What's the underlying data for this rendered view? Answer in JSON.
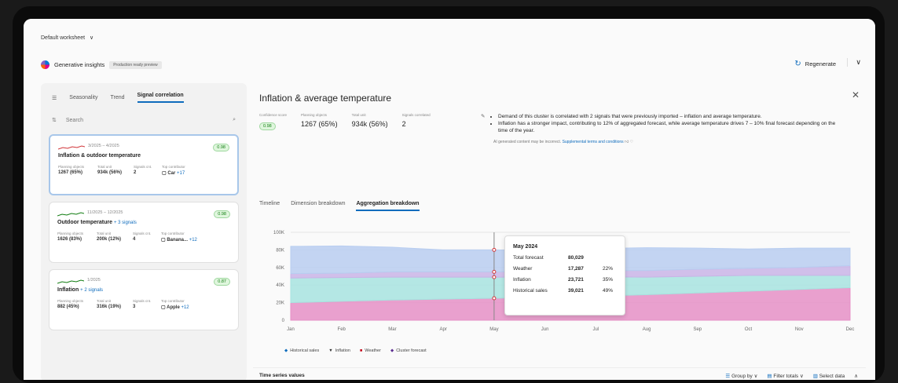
{
  "worksheet": {
    "label": "Default worksheet",
    "chevron": "∨"
  },
  "header": {
    "title": "Generative insights",
    "badge": "Production ready preview",
    "regenerate": "Regenerate",
    "regen_icon": "↻",
    "collapse": "∨"
  },
  "left": {
    "tabs": [
      {
        "label": "Seasonality"
      },
      {
        "label": "Trend"
      },
      {
        "label": "Signal correlation"
      }
    ],
    "search_placeholder": "Search",
    "cards": [
      {
        "date": "3/2025 – 4/2025",
        "title": "Inflation & outdoor temperature",
        "link": "",
        "score": "0.98",
        "h1": "Planning objects",
        "h2": "Total unit",
        "h3": "Signals cnt.",
        "h4": "Top contributor",
        "v1": "1267 (65%)",
        "v2": "934k (56%)",
        "v3": "2",
        "v4": "Car",
        "plus": "+17"
      },
      {
        "date": "11/2025 – 12/2025",
        "title": "Outdoor temperature",
        "link": "+ 3 signals",
        "score": "0.98",
        "h1": "Planning objects",
        "h2": "Total unit",
        "h3": "Signals cnt.",
        "h4": "Top contributor",
        "v1": "1626 (83%)",
        "v2": "200k (12%)",
        "v3": "4",
        "v4": "Banana...",
        "plus": "+12"
      },
      {
        "date": "1/2025",
        "title": "Inflation",
        "link": "+ 2 signals",
        "score": "0.87",
        "h1": "Planning objects",
        "h2": "Total unit",
        "h3": "Signals cnt.",
        "h4": "Top contributor",
        "v1": "882 (45%)",
        "v2": "316k (19%)",
        "v3": "3",
        "v4": "Apple",
        "plus": "+12"
      }
    ]
  },
  "main": {
    "title": "Inflation & average temperature",
    "stats": [
      {
        "h": "Confidence score",
        "v": "0.98"
      },
      {
        "h": "Planning objects",
        "v": "1267 (65%)"
      },
      {
        "h": "Total unit",
        "v": "934k (56%)"
      },
      {
        "h": "Signals correlated",
        "v": "2"
      }
    ],
    "ai_1": "Demand of this cluster is correlated with 2 signals that were previously imported – inflation and average temperature.",
    "ai_2": "Inflation has a stronger impact, contributing to 12% of aggregated forecast, while average temperature drives 7 – 10% final forecast depending on the time of the year.",
    "ai_foot": "AI generated content may be incorrect.",
    "ai_link": "Supplemental terms and conditions",
    "tabs": [
      {
        "label": "Timeline"
      },
      {
        "label": "Dimension breakdown"
      },
      {
        "label": "Aggregation breakdown"
      }
    ],
    "tooltip": {
      "title": "May 2024",
      "rows": [
        {
          "k": "Total forecast",
          "v": "80,029",
          "p": ""
        },
        {
          "k": "Weather",
          "v": "17,287",
          "p": "22%"
        },
        {
          "k": "Inflation",
          "v": "23,721",
          "p": "35%"
        },
        {
          "k": "Historical sales",
          "v": "39,021",
          "p": "49%"
        }
      ]
    },
    "legend": [
      {
        "label": "Historical sales",
        "color": "#0f6cbd",
        "mark": "◆"
      },
      {
        "label": "Inflation",
        "color": "#333333",
        "mark": "▼"
      },
      {
        "label": "Weather",
        "color": "#c50f1f",
        "mark": "■"
      },
      {
        "label": "Cluster forecast",
        "color": "#5c2e91",
        "mark": "◆"
      }
    ],
    "bottom": {
      "title": "Time series values",
      "group": "Group by",
      "filter": "Filter totals",
      "select": "Select data"
    }
  },
  "chart_data": {
    "type": "area",
    "categories": [
      "Jan",
      "Feb",
      "Mar",
      "Apr",
      "May",
      "Jun",
      "Jul",
      "Aug",
      "Sep",
      "Oct",
      "Nov",
      "Dec"
    ],
    "ytick_labels": [
      "0",
      "20K",
      "40K",
      "60K",
      "80K",
      "100K"
    ],
    "ylim": [
      0,
      100000
    ],
    "series": [
      {
        "name": "Historical sales",
        "color": "#e58fc6",
        "values": [
          20000,
          21500,
          23000,
          24000,
          25000,
          26000,
          27500,
          29000,
          31000,
          33000,
          35000,
          37000
        ]
      },
      {
        "name": "Weather",
        "color": "#a7e3df",
        "values": [
          28000,
          27000,
          26000,
          25000,
          24000,
          23000,
          22000,
          20000,
          19000,
          18000,
          16000,
          14000
        ]
      },
      {
        "name": "Inflation",
        "color": "#c9b4e6",
        "values": [
          5000,
          5000,
          6000,
          6000,
          6000,
          6500,
          7000,
          7500,
          8000,
          8000,
          9000,
          11000
        ]
      },
      {
        "name": "Cluster forecast",
        "color": "#b8cdf0",
        "values": [
          31000,
          31000,
          28000,
          25000,
          25000,
          24000,
          25000,
          26000,
          24000,
          22000,
          22000,
          20000
        ]
      }
    ],
    "marker_index": 4
  }
}
